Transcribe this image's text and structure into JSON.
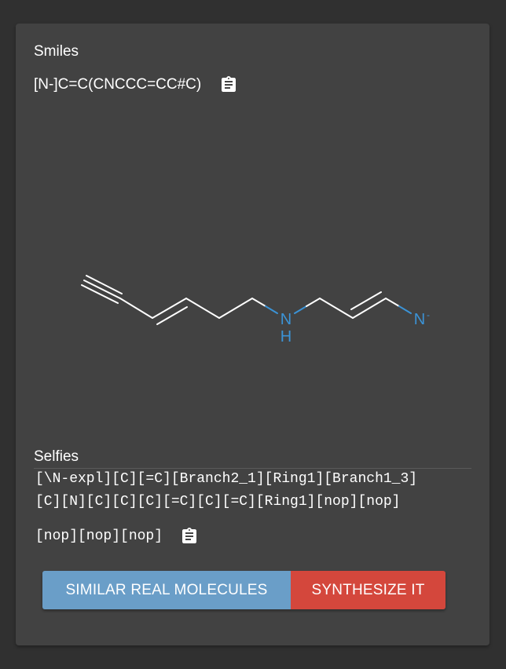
{
  "smiles": {
    "label": "Smiles",
    "value": "[N-]C=C(CNCCC=CC#C)",
    "copy_icon": "clipboard-icon"
  },
  "molecule": {
    "atoms": {
      "amine_n": "N",
      "amine_h": "H",
      "anion_n": "N",
      "anion_charge": "-"
    },
    "colors": {
      "bond": "#ffffff",
      "heteroatom": "#3b93d6"
    }
  },
  "selfies": {
    "label": "Selfies",
    "line1": "[\\N-expl][C][=C][Branch2_1][Ring1][Branch1_3]",
    "line2": "[C][N][C][C][C][=C][C][=C][Ring1][nop][nop]",
    "line3": "[nop][nop][nop]",
    "copy_icon": "clipboard-icon"
  },
  "actions": {
    "similar_label": "SIMILAR REAL MOLECULES",
    "synthesize_label": "SYNTHESIZE IT",
    "similar_color": "#6a9ec8",
    "synthesize_color": "#d4473c"
  }
}
